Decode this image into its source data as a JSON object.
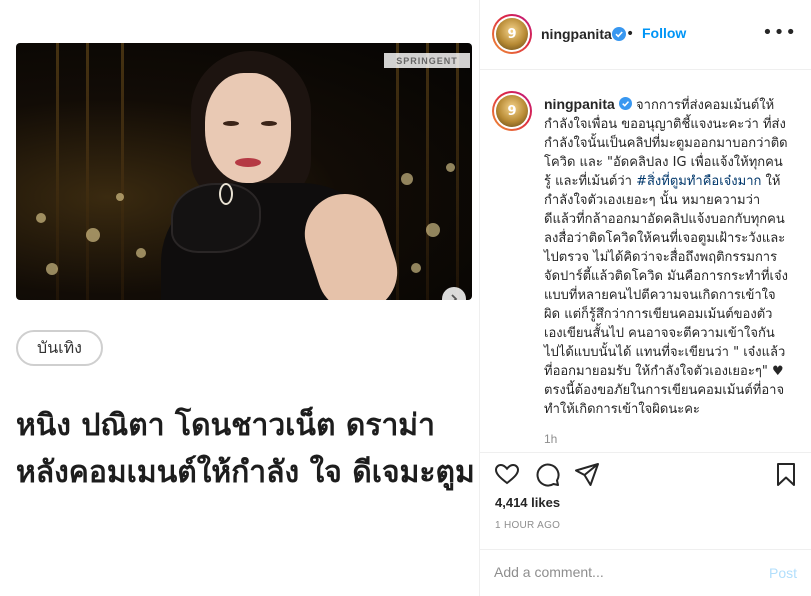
{
  "article": {
    "photo_brand": "SPRINGENT",
    "category_tag": "บันเทิง",
    "headline": "หนิง ปณิตา โดนชาวเน็ต ดราม่า หลังคอมเมนต์ให้กำลัง ใจ ดีเจมะตูม"
  },
  "post": {
    "header": {
      "username": "ningpanita",
      "avatar_text": "9",
      "separator": "•",
      "follow_label": "Follow",
      "more_icon": "more-horizontal-icon"
    },
    "caption": {
      "username": "ningpanita",
      "text_1": " จากการที่ส่งคอมเม้นต์ให้กำลังใจเพื่อน ขออนุญาติชี้แจงนะคะว่า ที่ส่งกำลังใจนั้นเป็นคลิปที่มะตูมออกมาบอกว่าติดโควิด และ \"อัดคลิปลง IG เพื่อแจ้งให้ทุกคนรู้ และที่เม้นต์ว่า ",
      "hashtag": "#สิ่งที่ตูมทำคือเจ๋งมาก",
      "text_2": " ให้กำลังใจตัวเองเยอะๆ นั้น หมายความว่า ดีแล้วที่กล้าออกมาอัดคลิปแจ้งบอกกับทุกคนลงสื่อว่าติดโควิดให้คนที่เจอตูมเฝ้าระวังและไปตรวจ ไม่ได้คิดว่าจะสื่อถึงพฤติกรรมการจัดปาร์ตี้แล้วติดโควิด มันคือการกระทำที่เจ๋ง แบบที่หลายคนไปตีความจนเกิดการเข้าใจผิด แต่ก็รู้สึกว่าการเขียนคอมเม้นต์ของตัวเองเขียนสั้นไป คนอาจจะตีความเข้าใจกันไปได้แบบนั้นได้ แทนที่จะเขียนว่า \" เจ๋งแล้วที่ออกมายอมรับ ให้กำลังใจตัวเองเยอะๆ\" ♥ ตรงนี้ต้องขอภัยในการเขียนคอมเม้นต์ที่อาจทำให้เกิดการเข้าใจผิดนะคะ",
      "age": "1h"
    },
    "likes": "4,414 likes",
    "timestamp": "1 HOUR AGO",
    "comment_placeholder": "Add a comment...",
    "post_label": "Post",
    "accent_color": "#0095f6"
  }
}
